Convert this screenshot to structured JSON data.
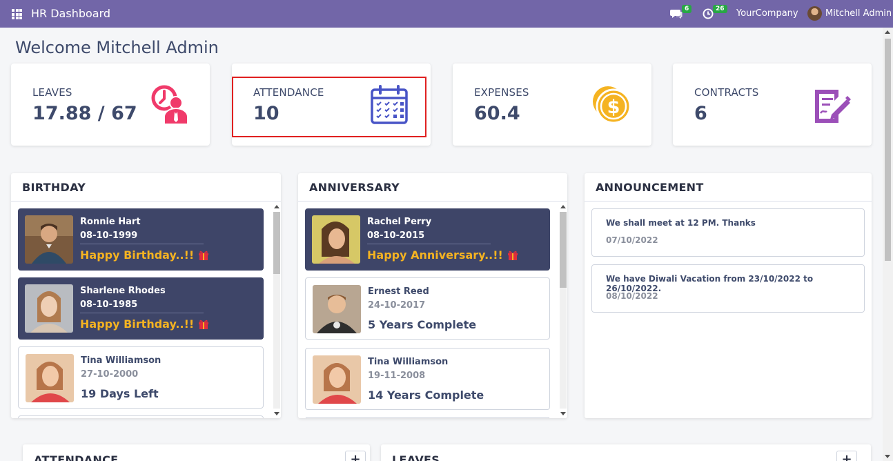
{
  "topbar": {
    "app_title": "HR Dashboard",
    "messages_count": "6",
    "activities_count": "26",
    "company": "YourCompany",
    "user_name": "Mitchell Admin",
    "bg_color": "#7266a8"
  },
  "welcome": "Welcome Mitchell Admin",
  "stats": [
    {
      "label": "LEAVES",
      "value": "17.88 / 67",
      "icon": "leave-clock-person-icon",
      "color": "#f03a6a"
    },
    {
      "label": "ATTENDANCE",
      "value": "10",
      "icon": "calendar-check-icon",
      "color": "#4854c6"
    },
    {
      "label": "EXPENSES",
      "value": "60.4",
      "icon": "dollar-coins-icon",
      "color": "#f5b321"
    },
    {
      "label": "CONTRACTS",
      "value": "6",
      "icon": "contract-edit-icon",
      "color": "#9b4fb8"
    }
  ],
  "birthday": {
    "title": "BIRTHDAY",
    "items": [
      {
        "name": "Ronnie Hart",
        "date": "08-10-1999",
        "note": "Happy Birthday..!!"
      },
      {
        "name": "Sharlene Rhodes",
        "date": "08-10-1985",
        "note": "Happy Birthday..!!"
      },
      {
        "name": "Tina Williamson",
        "date": "27-10-2000",
        "note": "19 Days Left"
      }
    ]
  },
  "anniversary": {
    "title": "ANNIVERSARY",
    "items": [
      {
        "name": "Rachel Perry",
        "date": "08-10-2015",
        "note": "Happy Anniversary..!!"
      },
      {
        "name": "Ernest Reed",
        "date": "24-10-2017",
        "note": "5 Years Complete"
      },
      {
        "name": "Tina Williamson",
        "date": "19-11-2008",
        "note": "14 Years Complete"
      }
    ]
  },
  "announcement": {
    "title": "ANNOUNCEMENT",
    "items": [
      {
        "text": "We shall meet at 12 PM. Thanks",
        "date": "07/10/2022"
      },
      {
        "text": "We have Diwali Vacation from 23/10/2022 to 26/10/2022.",
        "date": "08/10/2022"
      }
    ]
  },
  "bottom": {
    "attendance_title": "ATTENDANCE",
    "leaves_title": "LEAVES",
    "plus_label": "+"
  }
}
